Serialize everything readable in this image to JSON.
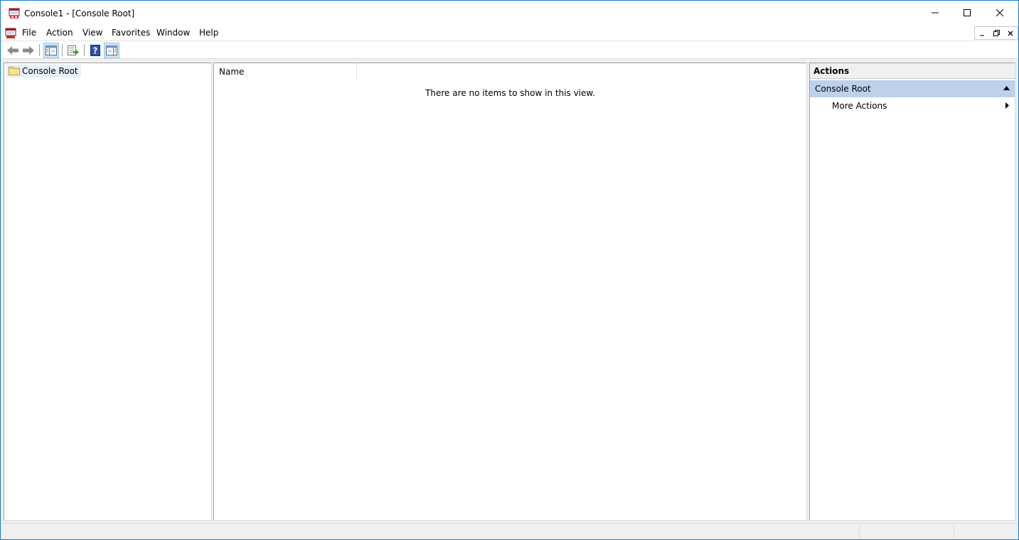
{
  "window": {
    "title": "Console1 - [Console Root]",
    "icon": "mmc-console-icon",
    "controls": [
      "minimize-icon",
      "maximize-icon",
      "close-icon"
    ]
  },
  "menubar": {
    "items": [
      {
        "label": "File"
      },
      {
        "label": "Action"
      },
      {
        "label": "View"
      },
      {
        "label": "Favorites"
      },
      {
        "label": "Window"
      },
      {
        "label": "Help"
      }
    ],
    "mdi_controls": [
      "mdi-minimize-icon",
      "mdi-restore-icon",
      "mdi-close-icon"
    ]
  },
  "toolbar": {
    "buttons": [
      "back-arrow-icon",
      "forward-arrow-icon",
      "show-hide-console-tree-icon",
      "export-list-icon",
      "help-icon",
      "show-hide-action-pane-icon"
    ]
  },
  "tree": {
    "root_label": "Console Root"
  },
  "results": {
    "column_name": "Name",
    "empty_message": "There are no items to show in this view."
  },
  "actions": {
    "header": "Actions",
    "section_title": "Console Root",
    "items": [
      {
        "label": "More Actions"
      }
    ]
  },
  "colors": {
    "selection": "#e5f1fb",
    "section_header": "#bdd1ea",
    "window_border": "#1979ca"
  }
}
